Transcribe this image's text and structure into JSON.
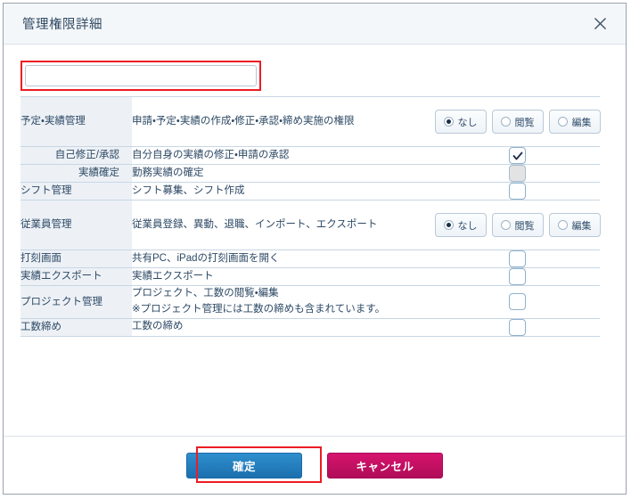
{
  "dialog": {
    "title": "管理権限詳細",
    "close_icon": "close-icon"
  },
  "name_field": {
    "value": "",
    "placeholder": ""
  },
  "radio_options": {
    "none": "なし",
    "view": "閲覧",
    "edit": "編集"
  },
  "rows": [
    {
      "label": "予定・実績管理",
      "description": "申請・予定・実績の作成・修正・承認・締め実施の権限",
      "control": "radio",
      "selected": "なし",
      "sub": false
    },
    {
      "label": "自己修正/承認",
      "description": "自分自身の実績の修正・申請の承認",
      "control": "checkbox",
      "checked": true,
      "disabled": false,
      "sub": true
    },
    {
      "label": "実績確定",
      "description": "勤務実績の確定",
      "control": "checkbox",
      "checked": false,
      "disabled": true,
      "sub": true
    },
    {
      "label": "シフト管理",
      "description": "シフト募集、シフト作成",
      "control": "checkbox",
      "checked": false,
      "disabled": false,
      "sub": false
    },
    {
      "label": "従業員管理",
      "description": "従業員登録、異動、退職、インポート、エクスポート",
      "control": "radio",
      "selected": "なし",
      "sub": false
    },
    {
      "label": "打刻画面",
      "description": "共有PC、iPadの打刻画面を開く",
      "control": "checkbox",
      "checked": false,
      "disabled": false,
      "sub": false
    },
    {
      "label": "実績エクスポート",
      "description": "実績エクスポート",
      "control": "checkbox",
      "checked": false,
      "disabled": false,
      "sub": false
    },
    {
      "label": "プロジェクト管理",
      "description": "プロジェクト、工数の閲覧・編集",
      "description2": "※プロジェクト管理には工数の締めも含まれています。",
      "control": "checkbox",
      "checked": false,
      "disabled": false,
      "sub": false
    },
    {
      "label": "工数締め",
      "description": "工数の締め",
      "control": "checkbox",
      "checked": false,
      "disabled": false,
      "sub": false
    }
  ],
  "footer": {
    "confirm_label": "確定",
    "cancel_label": "キャンセル"
  },
  "colors": {
    "accent_blue": "#1b6fae",
    "cancel_magenta": "#d6146e",
    "annotation_red": "#ed1c24",
    "label_bg": "#edf1f6",
    "text": "#2e4a66"
  }
}
